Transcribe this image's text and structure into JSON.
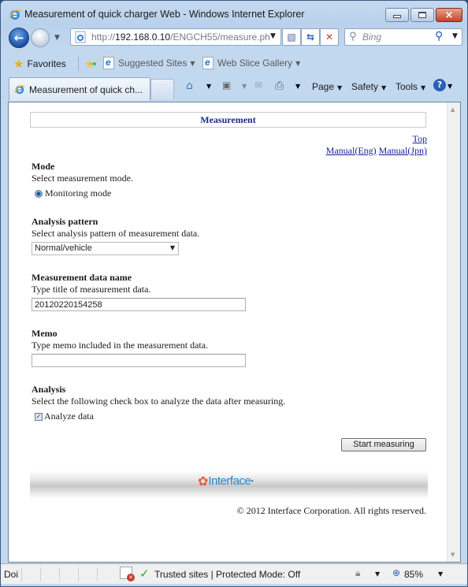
{
  "window": {
    "title": "Measurement of quick charger Web - Windows Internet Explorer",
    "controls": {
      "minimize": "minimize",
      "maximize": "maximize",
      "close": "×"
    }
  },
  "navigation": {
    "url_scheme": "http://",
    "url_host": "192.168.0.10",
    "url_path": "/ENGCH55/measure.ph",
    "search_placeholder": "Bing"
  },
  "favorites_bar": {
    "favorites_label": "Favorites",
    "items": [
      {
        "label": "Suggested Sites"
      },
      {
        "label": "Web Slice Gallery"
      }
    ]
  },
  "tabs": [
    {
      "label": "Measurement of quick ch..."
    }
  ],
  "command_bar": {
    "page_label": "Page",
    "safety_label": "Safety",
    "tools_label": "Tools"
  },
  "page": {
    "header_title": "Measurement",
    "links": {
      "top": "Top",
      "manual_eng": "Manual(Eng)",
      "manual_jpn": "Manual(Jpn)"
    },
    "mode": {
      "title": "Mode",
      "description": "Select measurement mode.",
      "option_label": "Monitoring mode",
      "selected": true
    },
    "analysis_pattern": {
      "title": "Analysis pattern",
      "description": "Select analysis pattern of measurement data.",
      "selected_value": "Normal/vehicle"
    },
    "measurement_data_name": {
      "title": "Measurement data name",
      "description": "Type title of measurement data.",
      "value": "20120220154258"
    },
    "memo": {
      "title": "Memo",
      "description": "Type memo included in the measurement data.",
      "value": ""
    },
    "analysis": {
      "title": "Analysis",
      "description": "Select the following check box to analyze the data after measuring.",
      "checkbox_label": "Analyze data",
      "checked": true
    },
    "start_button": "Start measuring",
    "logo_text": "Interface",
    "copyright": "© 2012 Interface Corporation. All rights reserved."
  },
  "status_bar": {
    "status_text": "Doi",
    "zone_text": "Trusted sites | Protected Mode: Off",
    "zoom_level": "85%"
  },
  "colors": {
    "link": "#1a1aa0",
    "header_title": "#1a2a8a",
    "brand_blue": "#2a86c8",
    "brand_orange": "#e8603a"
  }
}
